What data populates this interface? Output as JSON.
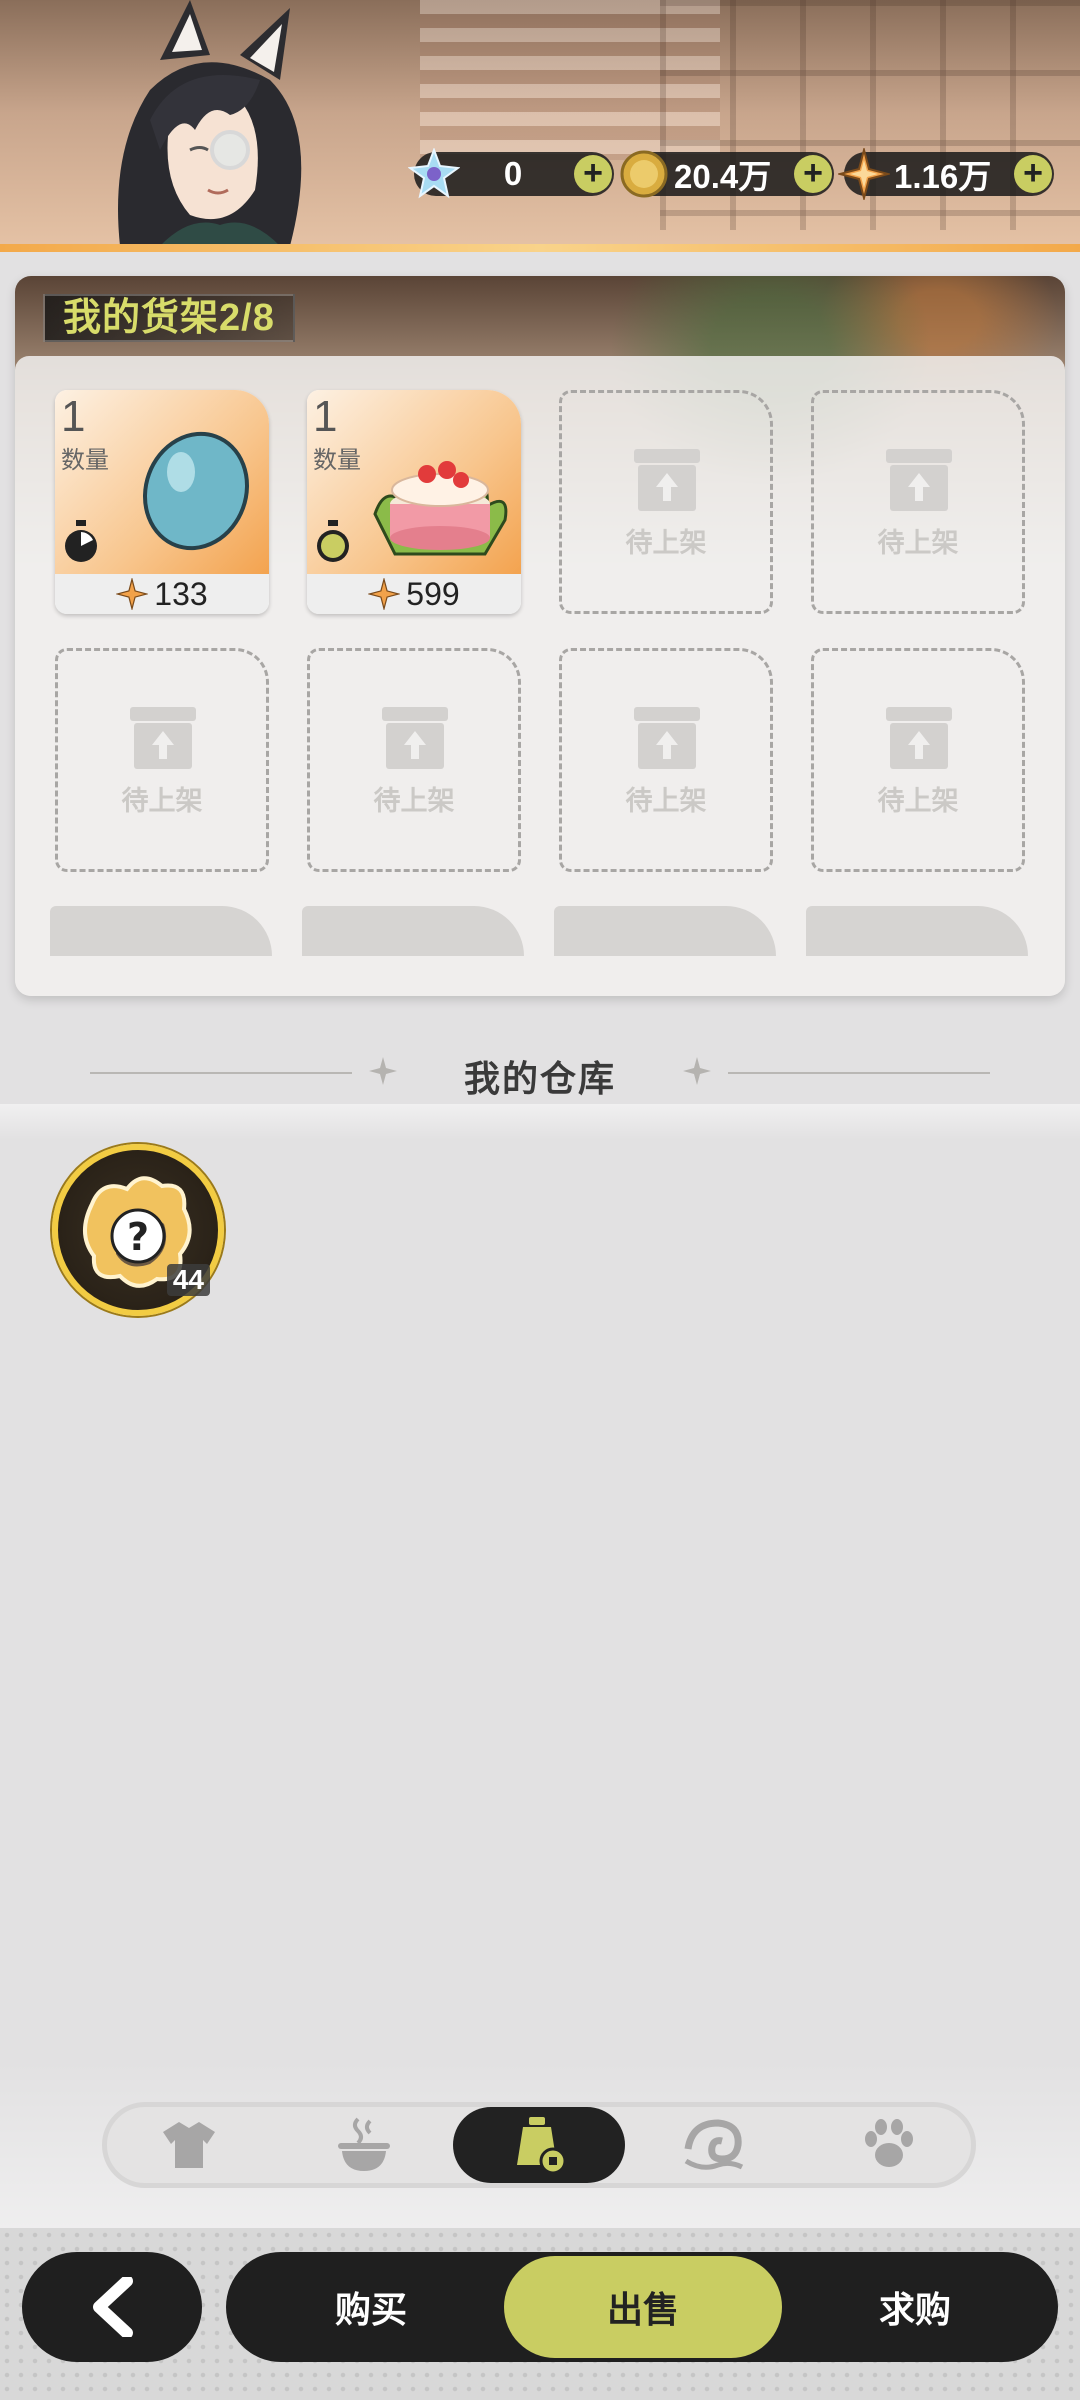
{
  "currency": {
    "crystal": {
      "value": "0",
      "icon": "crystal-icon"
    },
    "coin": {
      "value": "20.4万",
      "icon": "gold-coin-icon"
    },
    "star": {
      "value": "1.16万",
      "icon": "star-gem-icon"
    },
    "add_label": "+"
  },
  "shelf": {
    "title": "我的货架2/8",
    "qty_label": "数量",
    "empty_label": "待上架",
    "items": [
      {
        "qty": "1",
        "price": "133",
        "icon": "blue-egg-icon"
      },
      {
        "qty": "1",
        "price": "599",
        "icon": "strawberry-cake-icon"
      }
    ]
  },
  "warehouse": {
    "title": "我的仓库",
    "items": [
      {
        "count": "44",
        "icon": "mystery-item-icon"
      }
    ]
  },
  "categories": [
    {
      "icon": "shirt-icon"
    },
    {
      "icon": "cooking-pot-icon"
    },
    {
      "icon": "items-bag-icon",
      "active": true
    },
    {
      "icon": "wave-swirl-icon"
    },
    {
      "icon": "paw-icon"
    }
  ],
  "trade_tabs": {
    "buy": "购买",
    "sell": "出售",
    "request": "求购",
    "active": "sell"
  },
  "colors": {
    "accent": "#c9cd62",
    "title_yellow": "#d8dc6a",
    "dark": "#1f1f1f",
    "background": "#e2e1e2"
  }
}
